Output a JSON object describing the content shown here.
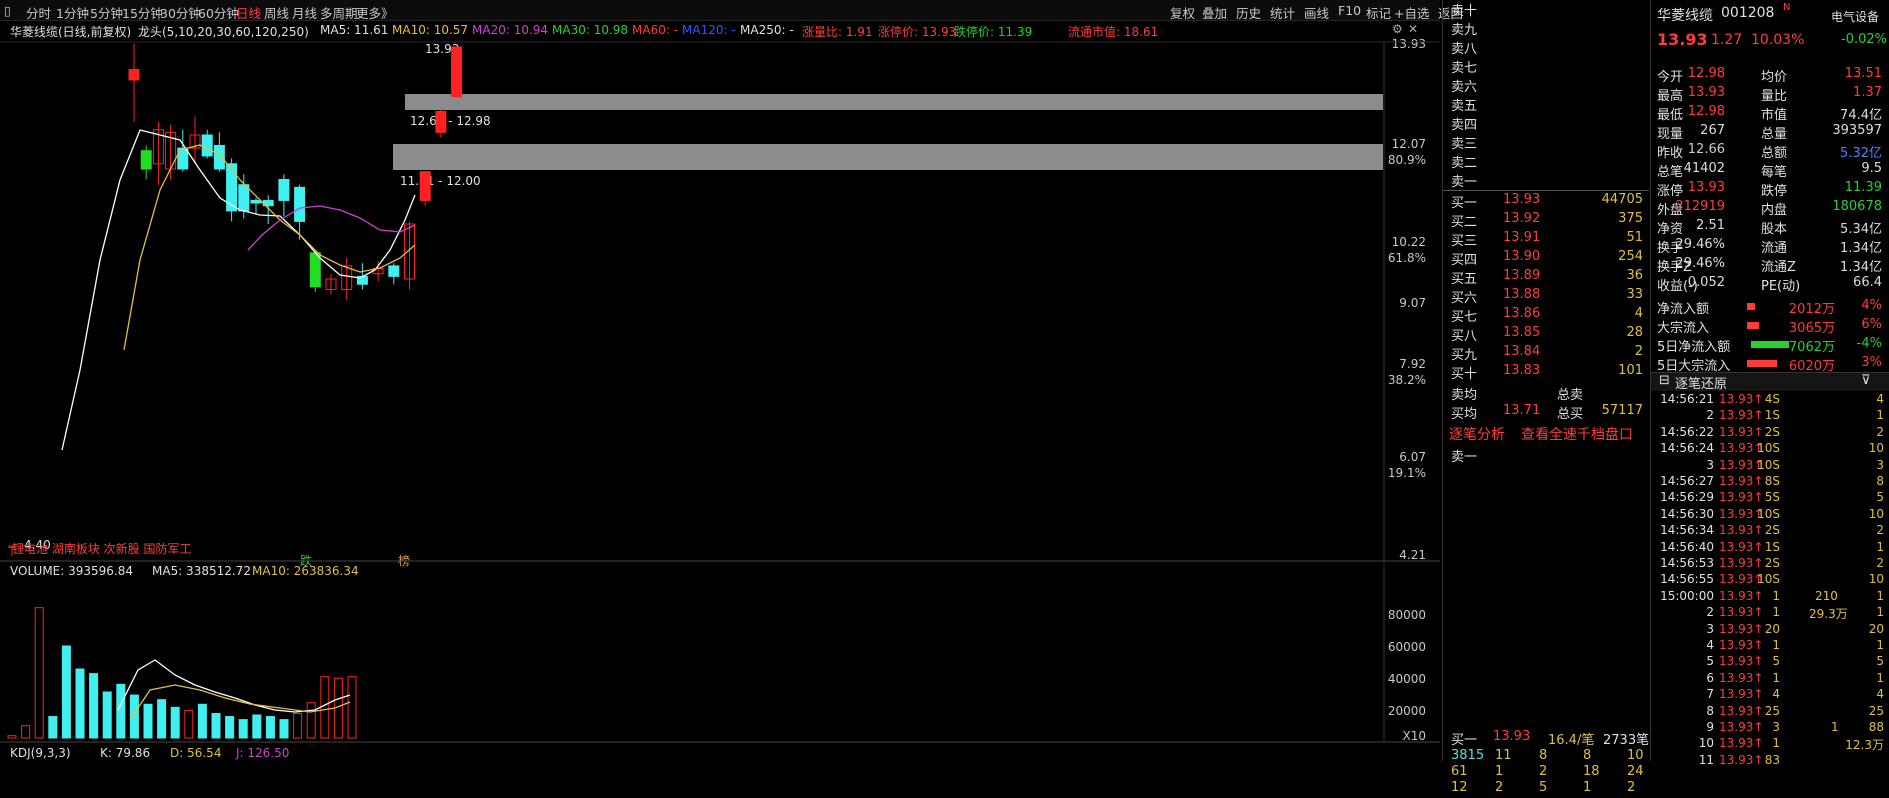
{
  "toolbar": {
    "periods": [
      "分时",
      "1分钟",
      "5分钟",
      "15分钟",
      "30分钟",
      "60分钟",
      "日线",
      "周线",
      "月线",
      "多周期",
      "更多》"
    ],
    "active_period": "日线",
    "tools": [
      "复权",
      "叠加",
      "历史",
      "统计",
      "画线",
      "F10",
      "标记",
      "+自选",
      "返回"
    ]
  },
  "chart_header": {
    "name": "华菱线缆(日线,前复权)",
    "indicator": "龙头(5,10,20,30,60,120,250)",
    "ma5": "MA5: 11.61",
    "ma10": "MA10: 10.57",
    "ma20": "MA20: 10.94",
    "ma30": "MA30: 10.98",
    "ma60": "MA60: -",
    "ma120": "MA120: -",
    "ma250": "MA250: -",
    "zhangliang": "涨量比: 1.91",
    "zhangting": "涨停价: 13.93",
    "dieting": "跌停价: 11.39",
    "liutong": "流通市值: 18.61"
  },
  "price_axis": [
    "13.93",
    "12.07",
    "10.22",
    "9.07",
    "7.92",
    "6.07",
    "4.21"
  ],
  "pct_axis": [
    "80.9%",
    "61.8%",
    "38.2%",
    "19.1%"
  ],
  "annotations": {
    "high_label": "13.93",
    "zone1": "12.66 - 12.98",
    "zone2": "11.51 - 12.00",
    "low_label": "4.40",
    "tags": "锂电池 湖南板块 次新股 国防军工",
    "mark_die": "跌",
    "mark_bang": "榜"
  },
  "chart_data": {
    "type": "candlestick",
    "series_price": [
      {
        "o": 4.4,
        "h": 4.4,
        "l": 4.21,
        "c": 4.4
      },
      {
        "o": 13.3,
        "h": 14.0,
        "l": 12.5,
        "c": 13.5
      },
      {
        "o": 11.95,
        "h": 12.05,
        "l": 11.4,
        "c": 11.6
      },
      {
        "o": 11.7,
        "h": 12.5,
        "l": 11.3,
        "c": 12.35
      },
      {
        "o": 11.6,
        "h": 12.45,
        "l": 11.4,
        "c": 12.3
      },
      {
        "o": 12.0,
        "h": 12.35,
        "l": 11.55,
        "c": 11.6
      },
      {
        "o": 12.0,
        "h": 12.6,
        "l": 11.7,
        "c": 12.25
      },
      {
        "o": 12.25,
        "h": 12.35,
        "l": 11.8,
        "c": 11.85
      },
      {
        "o": 12.05,
        "h": 12.3,
        "l": 11.55,
        "c": 11.6
      },
      {
        "o": 11.7,
        "h": 11.8,
        "l": 10.6,
        "c": 10.8
      },
      {
        "o": 11.3,
        "h": 11.5,
        "l": 10.65,
        "c": 10.8
      },
      {
        "o": 11.0,
        "h": 11.05,
        "l": 10.75,
        "c": 10.95
      },
      {
        "o": 11.0,
        "h": 11.1,
        "l": 10.55,
        "c": 10.9
      },
      {
        "o": 11.4,
        "h": 11.5,
        "l": 10.7,
        "c": 11.0
      },
      {
        "o": 11.25,
        "h": 11.3,
        "l": 10.25,
        "c": 10.6
      },
      {
        "o": 10.0,
        "h": 10.05,
        "l": 9.25,
        "c": 9.35
      },
      {
        "o": 9.3,
        "h": 9.6,
        "l": 9.2,
        "c": 9.5
      },
      {
        "o": 9.3,
        "h": 9.9,
        "l": 9.1,
        "c": 9.75
      },
      {
        "o": 9.55,
        "h": 9.8,
        "l": 9.3,
        "c": 9.4
      },
      {
        "o": 9.6,
        "h": 9.85,
        "l": 9.45,
        "c": 9.7
      },
      {
        "o": 9.75,
        "h": 9.8,
        "l": 9.4,
        "c": 9.55
      },
      {
        "o": 9.5,
        "h": 10.6,
        "l": 9.3,
        "c": 10.55
      },
      {
        "o": 11.0,
        "h": 11.55,
        "l": 10.9,
        "c": 11.55
      },
      {
        "o": 12.3,
        "h": 12.75,
        "l": 12.2,
        "c": 12.7
      },
      {
        "o": 12.98,
        "h": 13.93,
        "l": 12.98,
        "c": 13.93
      }
    ],
    "volume": {
      "title": "VOLUME: 393596.84",
      "ma5": "MA5: 338512.72",
      "ma10": "MA10: 263836.34",
      "axis": [
        "80000",
        "60000",
        "40000",
        "20000"
      ],
      "unit": "X10"
    },
    "kdj": {
      "label": "KDJ(9,3,3)",
      "k": "K: 79.86",
      "d": "D: 56.54",
      "j": "J: 126.50"
    }
  },
  "orderbook": {
    "sells": [
      {
        "label": "卖十",
        "price": "",
        "vol": ""
      },
      {
        "label": "卖九",
        "price": "",
        "vol": ""
      },
      {
        "label": "卖八",
        "price": "",
        "vol": ""
      },
      {
        "label": "卖七",
        "price": "",
        "vol": ""
      },
      {
        "label": "卖六",
        "price": "",
        "vol": ""
      },
      {
        "label": "卖五",
        "price": "",
        "vol": ""
      },
      {
        "label": "卖四",
        "price": "",
        "vol": ""
      },
      {
        "label": "卖三",
        "price": "",
        "vol": ""
      },
      {
        "label": "卖二",
        "price": "",
        "vol": ""
      },
      {
        "label": "卖一",
        "price": "",
        "vol": ""
      }
    ],
    "buys": [
      {
        "label": "买一",
        "price": "13.93",
        "vol": "44705"
      },
      {
        "label": "买二",
        "price": "13.92",
        "vol": "375"
      },
      {
        "label": "买三",
        "price": "13.91",
        "vol": "51"
      },
      {
        "label": "买四",
        "price": "13.90",
        "vol": "254"
      },
      {
        "label": "买五",
        "price": "13.89",
        "vol": "36"
      },
      {
        "label": "买六",
        "price": "13.88",
        "vol": "33"
      },
      {
        "label": "买七",
        "price": "13.86",
        "vol": "4"
      },
      {
        "label": "买八",
        "price": "13.85",
        "vol": "28"
      },
      {
        "label": "买九",
        "price": "13.84",
        "vol": "2"
      },
      {
        "label": "买十",
        "price": "13.83",
        "vol": "101"
      }
    ],
    "avg_sell_label": "卖均",
    "avg_sell": "",
    "total_sell_label": "总卖",
    "total_sell": "",
    "avg_buy_label": "买均",
    "avg_buy": "13.71",
    "total_buy_label": "总买",
    "total_buy": "57117",
    "link1": "逐笔分析",
    "link2": "查看全速千档盘口",
    "sell1_label": "卖一",
    "bottom_label": "买一",
    "bottom_price": "13.93",
    "bottom_avg": "16.4/笔",
    "bottom_count": "2733笔",
    "bottom_rows": [
      [
        "3815",
        "11",
        "8",
        "8",
        "10"
      ],
      [
        "61",
        "1",
        "2",
        "18",
        "24"
      ],
      [
        "12",
        "2",
        "5",
        "1",
        "2"
      ]
    ]
  },
  "info": {
    "name": "华菱线缆",
    "code": "001208",
    "badge": "N",
    "industry": "电气设备",
    "price": "13.93",
    "change": "1.27",
    "pct": "10.03%",
    "industry_pct": "-0.02%",
    "stats": [
      [
        "今开",
        "12.98",
        "均价",
        "13.51"
      ],
      [
        "最高",
        "13.93",
        "量比",
        "1.37"
      ],
      [
        "最低",
        "12.98",
        "市值",
        "74.4亿"
      ],
      [
        "现量",
        "267",
        "总量",
        "393597"
      ],
      [
        "昨收",
        "12.66",
        "总额",
        "5.32亿"
      ],
      [
        "总笔",
        "41402",
        "每笔",
        "9.5"
      ],
      [
        "涨停",
        "13.93",
        "跌停",
        "11.39"
      ],
      [
        "外盘",
        "212919",
        "内盘",
        "180678"
      ],
      [
        "净资",
        "2.51",
        "股本",
        "5.34亿"
      ],
      [
        "换手",
        "29.46%",
        "流通",
        "1.34亿"
      ],
      [
        "换手Z",
        "29.46%",
        "流通Z",
        "1.34亿"
      ],
      [
        "收益(-)",
        "0.052",
        "PE(动)",
        "66.4"
      ]
    ],
    "flows": [
      {
        "label": "净流入额",
        "val": "2012万",
        "pct": "4%"
      },
      {
        "label": "大宗流入",
        "val": "3065万",
        "pct": "6%"
      },
      {
        "label": "5日净流入额",
        "val": "-7062万",
        "pct": "-4%"
      },
      {
        "label": "5日大宗流入",
        "val": "6020万",
        "pct": "3%"
      }
    ],
    "ticks_title": "逐笔还原",
    "ticks": [
      [
        "14:56:21",
        "13.93",
        "4S",
        "4"
      ],
      [
        "2",
        "13.93",
        "1S",
        "1"
      ],
      [
        "14:56:22",
        "13.93",
        "2S",
        "2"
      ],
      [
        "14:56:24",
        "13.93",
        "10S",
        "10"
      ],
      [
        "3",
        "13.93",
        "10S",
        "3"
      ],
      [
        "14:56:27",
        "13.93",
        "8S",
        "8"
      ],
      [
        "14:56:29",
        "13.93",
        "5S",
        "5"
      ],
      [
        "14:56:30",
        "13.93",
        "10S",
        "10"
      ],
      [
        "14:56:34",
        "13.93",
        "2S",
        "2"
      ],
      [
        "14:56:40",
        "13.93",
        "1S",
        "1"
      ],
      [
        "14:56:53",
        "13.93",
        "2S",
        "2"
      ],
      [
        "14:56:55",
        "13.93",
        "10S",
        "10"
      ],
      [
        "15:00:00",
        "13.93",
        "1",
        "1"
      ],
      [
        "2",
        "13.93",
        "1",
        "1"
      ],
      [
        "3",
        "13.93",
        "20",
        "20"
      ],
      [
        "4",
        "13.93",
        "1",
        "1"
      ],
      [
        "5",
        "13.93",
        "5",
        "5"
      ],
      [
        "6",
        "13.93",
        "1",
        "1"
      ],
      [
        "7",
        "13.93",
        "4",
        "4"
      ],
      [
        "8",
        "13.93",
        "25",
        "25"
      ],
      [
        "9",
        "13.93",
        "3",
        "88"
      ],
      [
        "10",
        "13.93",
        "1",
        "12.3万"
      ],
      [
        "11",
        "13.93",
        "83",
        ""
      ]
    ],
    "tick_side_vals": [
      "210",
      "29.3万",
      "1"
    ]
  }
}
